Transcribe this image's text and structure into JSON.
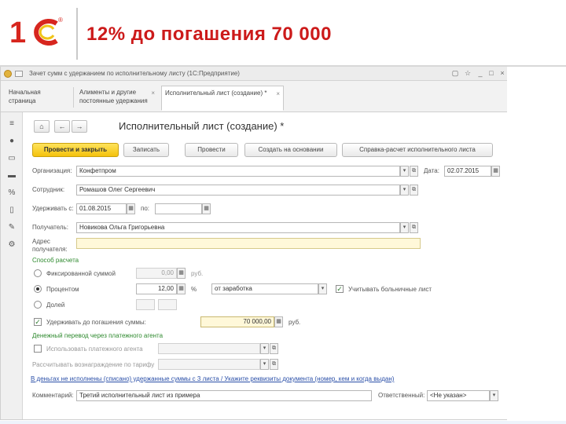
{
  "slide": {
    "title": "12% до погашения 70 000",
    "logo_text": "1С"
  },
  "window": {
    "title_text": "Зачет сумм с удержанием по исполнительному листу (1С:Предприятие)"
  },
  "tabs": [
    {
      "label": "Начальная страница"
    },
    {
      "label": "Алименты и другие постоянные удержания"
    },
    {
      "label": "Исполнительный лист (создание) *"
    }
  ],
  "form": {
    "title": "Исполнительный лист (создание) *",
    "buttons": {
      "post_close": "Провести и закрыть",
      "save": "Записать",
      "post": "Провести",
      "create_based": "Создать на основании",
      "report": "Справка-расчет исполнительного листа"
    },
    "labels": {
      "organization": "Организация:",
      "date": "Дата:",
      "employee": "Сотрудник:",
      "hold_from": "Удерживать с:",
      "to": "по:",
      "recipient": "Получатель:",
      "address": "Адрес получателя:",
      "calc_method": "Способ расчета",
      "fixed_sum": "Фиксированной суммой",
      "rub": "руб.",
      "percent": "Процентом",
      "percent_sign": "%",
      "share": "Долей",
      "consider_sick": "Учитывать больничные лист",
      "limit": "Удерживать до погашения суммы:",
      "money_transfer": "Денежный перевод через платежного агента",
      "use_agent": "Использовать платежного агента",
      "calc_tariff": "Рассчитывать вознаграждение по тарифу",
      "comment": "Комментарий:",
      "responsible": "Ответственный:"
    },
    "values": {
      "organization": "Конфетпром",
      "date": "02.07.2015",
      "employee": "Ромашов Олег Сергеевич",
      "hold_from": "01.08.2015",
      "hold_to": "",
      "recipient": "Новикова Ольга Григорьевна",
      "fixed_sum": "0,00",
      "percent_value": "12,00",
      "percent_basis": "от заработка",
      "limit_sum": "70 000,00",
      "comment": "Третий исполнительный лист из примера",
      "responsible": "<Не указан>"
    },
    "link_text": "В деньгах не исполнены (списано) удержанные суммы с 3 листа / Укажите реквизиты документа (номер, кем и когда выдан)"
  }
}
